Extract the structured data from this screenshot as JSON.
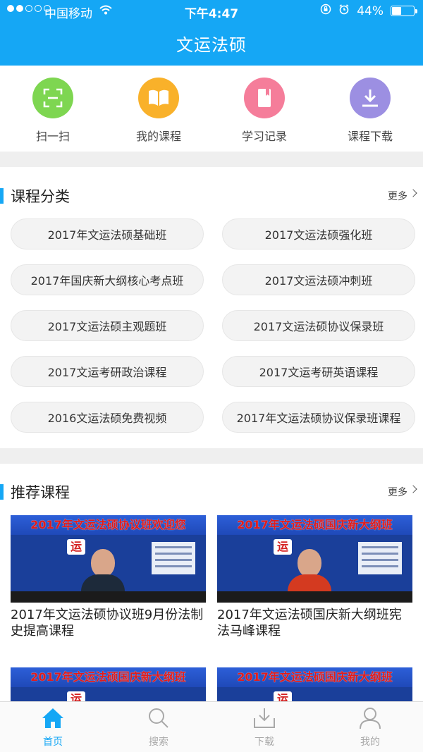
{
  "status_bar": {
    "carrier": "中国移动",
    "time": "下午4:47",
    "battery_text": "44%",
    "battery_level": 0.44
  },
  "header": {
    "title": "文运法硕"
  },
  "quick_nav": [
    {
      "label": "扫一扫",
      "icon": "scan-icon",
      "color": "#7ed651"
    },
    {
      "label": "我的课程",
      "icon": "book-icon",
      "color": "#f9b12a"
    },
    {
      "label": "学习记录",
      "icon": "bookmark-icon",
      "color": "#f57d9a"
    },
    {
      "label": "课程下载",
      "icon": "download-icon",
      "color": "#9c8fe2"
    }
  ],
  "categories_section": {
    "title": "课程分类",
    "more": "更多",
    "items": [
      "2017年文运法硕基础班",
      "2017文运法硕强化班",
      "2017年国庆新大纲核心考点班",
      "2017文运法硕冲刺班",
      "2017文运法硕主观题班",
      "2017文运法硕协议保录班",
      "2017文运考研政治课程",
      "2017文运考研英语课程",
      "2016文运法硕免费视频",
      "2017年文运法硕协议保录班课程"
    ]
  },
  "recommended_section": {
    "title": "推荐课程",
    "more": "更多",
    "courses": [
      {
        "banner": "2017年文运法硕协议班欢迎您",
        "logo": "运",
        "title": "2017年文运法硕协议班9月份法制史提高课程",
        "shirt_color": "#1d2a3a"
      },
      {
        "banner": "2017年文运法硕国庆新大纲班",
        "logo": "运",
        "title": "2017年文运法硕国庆新大纲班宪法马峰课程",
        "shirt_color": "#d43a20"
      },
      {
        "banner": "2017年文运法硕国庆新大纲班",
        "logo": "运",
        "title": "",
        "shirt_color": "#1d2a3a"
      },
      {
        "banner": "2017年文运法硕国庆新大纲班",
        "logo": "运",
        "title": "",
        "shirt_color": "#1d2a3a"
      }
    ]
  },
  "tab_bar": {
    "tabs": [
      {
        "label": "首页",
        "icon": "home-icon",
        "active": true
      },
      {
        "label": "搜索",
        "icon": "search-icon",
        "active": false
      },
      {
        "label": "下载",
        "icon": "download-tab-icon",
        "active": false
      },
      {
        "label": "我的",
        "icon": "profile-icon",
        "active": false
      }
    ]
  },
  "colors": {
    "accent": "#15a7f5",
    "page_bg": "#ffffff",
    "separator": "#efefef"
  }
}
